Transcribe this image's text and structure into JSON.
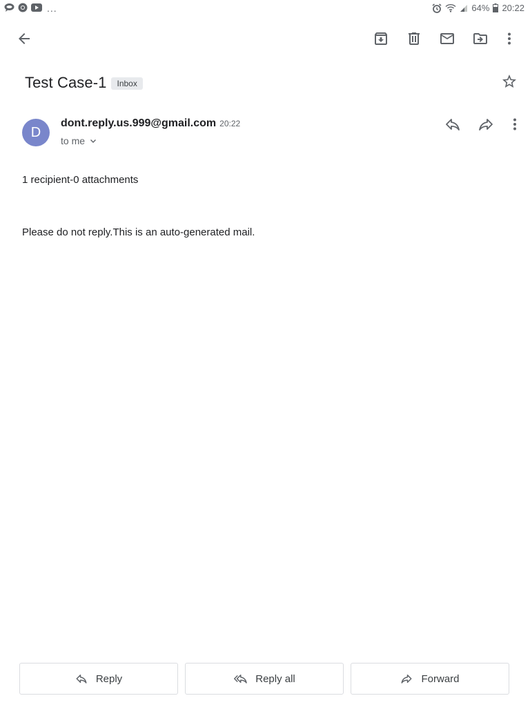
{
  "status_bar": {
    "left_icons": [
      "chat-bubble-icon",
      "chrome-icon",
      "youtube-icon"
    ],
    "overflow": "...",
    "battery_percent": "64%",
    "time": "20:22"
  },
  "toolbar": {
    "actions": [
      "back-arrow-icon",
      "archive-icon",
      "delete-icon",
      "mark-unread-icon",
      "move-to-icon",
      "more-vert-icon"
    ]
  },
  "email": {
    "subject": "Test Case-1",
    "label": "Inbox",
    "sender": {
      "avatar_letter": "D",
      "email": "dont.reply.us.999@gmail.com",
      "time": "20:22",
      "recipient_text": "to me"
    },
    "meta": "1 recipient-0 attachments",
    "body": "Please do not reply.This is an auto-generated mail."
  },
  "bottom_actions": {
    "reply": "Reply",
    "reply_all": "Reply all",
    "forward": "Forward"
  },
  "colors": {
    "avatar_bg": "#7986cb",
    "icon_gray": "#5f6368",
    "chip_bg": "#e8eaed",
    "border": "#dadce0"
  }
}
